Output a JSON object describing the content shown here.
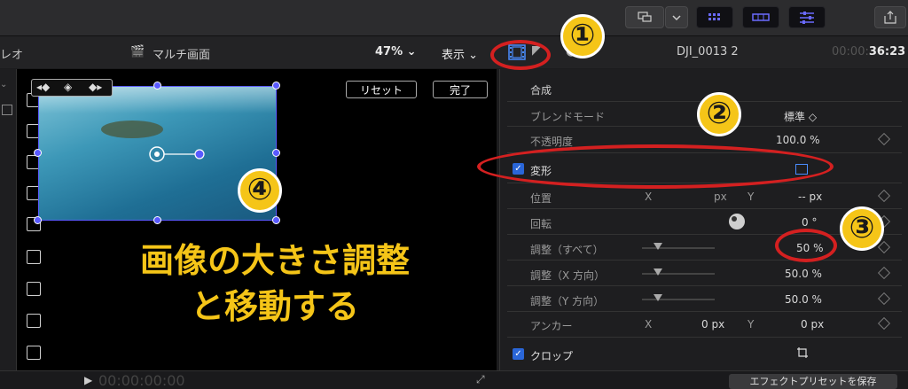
{
  "viewer_header": {
    "left_label": "レオ",
    "clip_title": "マルチ画面",
    "zoom": "47%",
    "view_menu": "表示"
  },
  "viewer": {
    "reset_label": "リセット",
    "done_label": "完了",
    "timecode": "00:00:00:00"
  },
  "inspector_header": {
    "clip_name": "DJI_0013 2",
    "duration_prefix": "00:00:",
    "duration_main": "36:23"
  },
  "inspector": {
    "compositing": {
      "section_title": "合成",
      "blend_mode_label": "ブレンドモード",
      "blend_mode_value": "標準 ◇",
      "opacity_label": "不透明度",
      "opacity_value": "100.0 %"
    },
    "transform": {
      "section_title": "変形",
      "position_label": "位置",
      "position_x_label": "X",
      "position_x_unit": "px",
      "position_y_label": "Y",
      "position_y_value": "-- px",
      "rotation_label": "回転",
      "rotation_value": "0 °",
      "scale_all_label": "調整（すべて）",
      "scale_all_value": "50 %",
      "scale_x_label": "調整（X 方向）",
      "scale_x_value": "50.0 %",
      "scale_y_label": "調整（Y 方向）",
      "scale_y_value": "50.0 %",
      "anchor_label": "アンカー",
      "anchor_x_label": "X",
      "anchor_x_value": "0 px",
      "anchor_y_label": "Y",
      "anchor_y_value": "0 px"
    },
    "crop": {
      "section_title": "クロップ"
    },
    "save_preset_label": "エフェクトプリセットを保存"
  },
  "annotations": {
    "num1": "①",
    "num2": "②",
    "num3": "③",
    "num4": "④",
    "caption_line1": "画像の大きさ調整",
    "caption_line2": "と移動する",
    "highlight_color": "#d42020",
    "marker_color": "#f5c518"
  }
}
